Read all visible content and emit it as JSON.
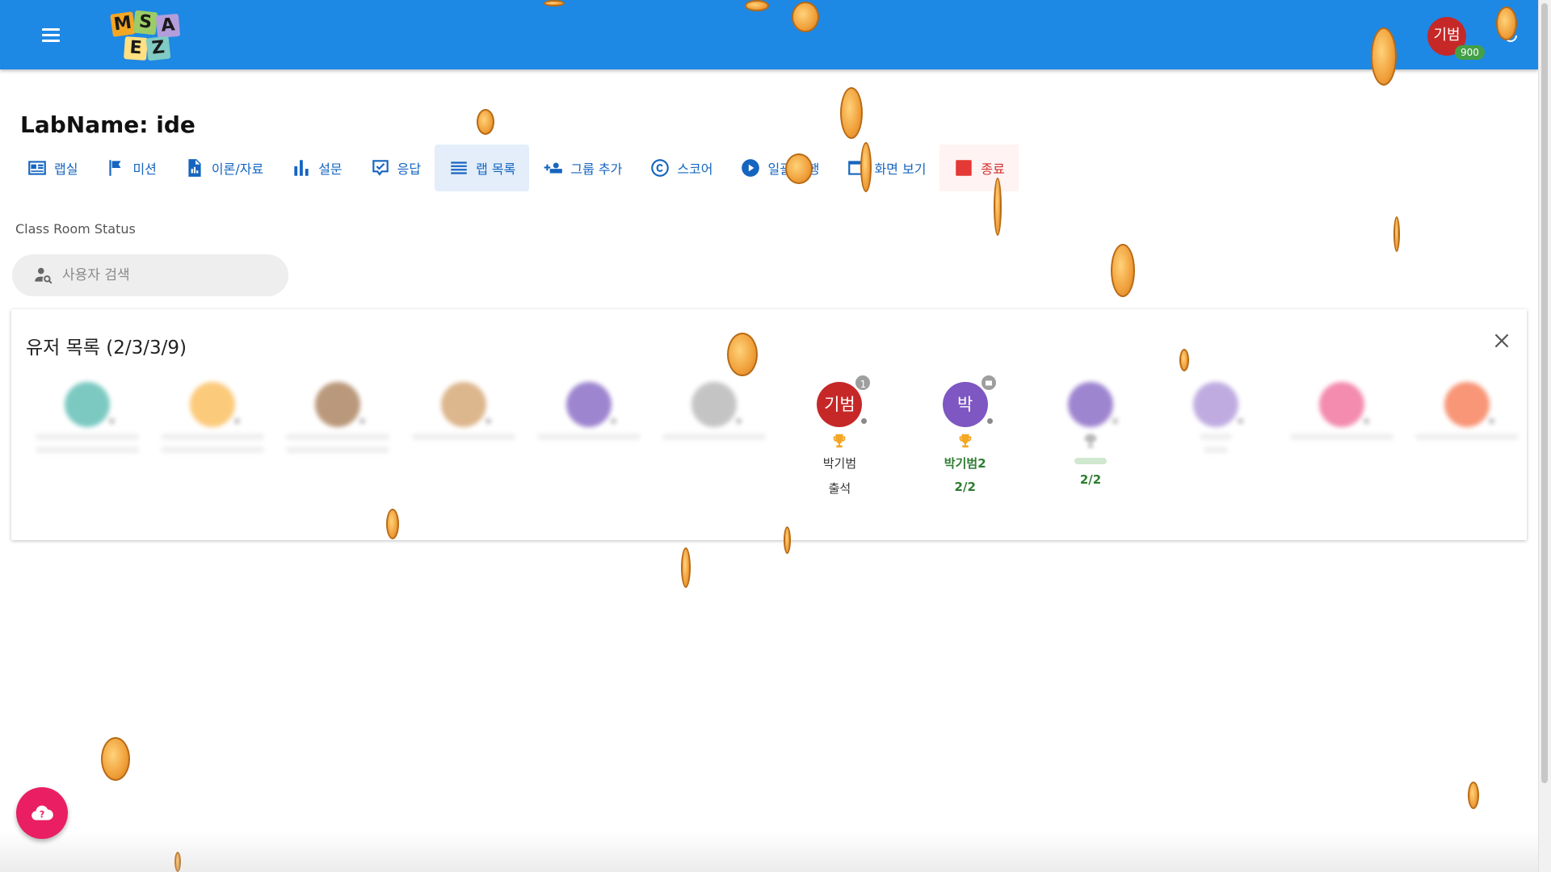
{
  "appbar": {
    "logo_letters": [
      "M",
      "S",
      "A",
      "E",
      "Z"
    ],
    "user_initials": "기범",
    "user_points": "900"
  },
  "page": {
    "title": "LabName: ide",
    "section_label": "Class Room Status"
  },
  "toolbar": [
    {
      "label": "랩실",
      "icon": "lab-card-icon"
    },
    {
      "label": "미션",
      "icon": "flag-icon"
    },
    {
      "label": "이론/자료",
      "icon": "document-chart-icon"
    },
    {
      "label": "설문",
      "icon": "bar-chart-icon"
    },
    {
      "label": "응답",
      "icon": "checkbox-comment-icon"
    },
    {
      "label": "랩 목록",
      "icon": "list-icon",
      "active": true
    },
    {
      "label": "그룹 추가",
      "icon": "group-add-icon"
    },
    {
      "label": "스코어",
      "icon": "copyright-score-icon"
    },
    {
      "label": "일괄 실행",
      "icon": "play-circle-icon"
    },
    {
      "label": "화면 보기",
      "icon": "screen-icon"
    },
    {
      "label": "종료",
      "icon": "stop-icon",
      "danger": true
    }
  ],
  "search": {
    "placeholder": "사용자 검색",
    "value": ""
  },
  "user_list": {
    "title": "유저 목록 (2/3/3/9)",
    "users": [
      {
        "avatar": "",
        "color": "#26a69a",
        "blurred": true
      },
      {
        "avatar": "",
        "color": "#f9a825",
        "blurred": true
      },
      {
        "avatar": "",
        "color": "#8d5524",
        "blurred": true
      },
      {
        "avatar": "",
        "color": "#c68642",
        "blurred": true
      },
      {
        "avatar": "",
        "color": "#5e35b1",
        "blurred": true
      },
      {
        "avatar": "",
        "color": "#9e9e9e",
        "blurred": true
      },
      {
        "avatar": "기범",
        "color": "#c62828",
        "badge": "1",
        "name": "박기범",
        "status": "출석",
        "status_green": false
      },
      {
        "avatar": "박",
        "color": "#7e57c2",
        "badge_icon": true,
        "name": "박기범2",
        "status": "2/2",
        "status_green": true
      },
      {
        "avatar": "",
        "color": "#5e35b1",
        "status": "2/2",
        "status_green": true,
        "blurred": true,
        "keep_status": true
      },
      {
        "avatar": "",
        "color": "#9575cd",
        "blurred": true
      },
      {
        "avatar": "",
        "color": "#ec407a",
        "blurred": true
      },
      {
        "avatar": "",
        "color": "#f4511e",
        "blurred": true
      }
    ]
  },
  "colors": {
    "appbar": "#1e88e5",
    "primary_text": "#1565c0",
    "danger": "#e53935",
    "fab": "#e91e63",
    "success": "#2e7d32"
  }
}
